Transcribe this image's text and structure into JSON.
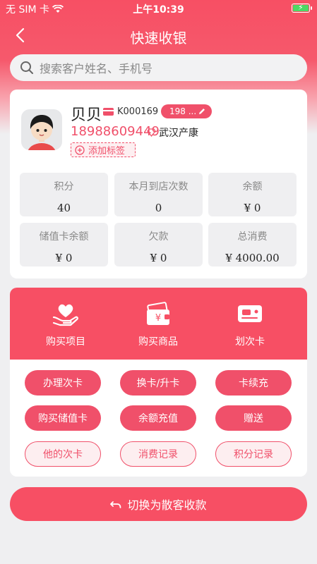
{
  "status_bar": {
    "carrier": "无 SIM 卡",
    "time": "上午10:39"
  },
  "nav": {
    "title": "快速收银"
  },
  "search": {
    "placeholder": "搜索客户姓名、手机号"
  },
  "customer": {
    "name": "贝贝",
    "card_no": "K000169",
    "tag_pill": "198 ...",
    "phone": "18988609449",
    "store": "武汉产康",
    "add_tag_label": "添加标签"
  },
  "stats": [
    {
      "label": "积分",
      "value": "40"
    },
    {
      "label": "本月到店次数",
      "value": "0"
    },
    {
      "label": "余额",
      "value": "¥ 0"
    },
    {
      "label": "储值卡余额",
      "value": "¥ 0"
    },
    {
      "label": "欠款",
      "value": "¥ 0"
    },
    {
      "label": "总消费",
      "value": "¥ 4000.00"
    }
  ],
  "actions": [
    {
      "label": "购买项目",
      "icon": "heart-hand-icon"
    },
    {
      "label": "购买商品",
      "icon": "money-wallet-icon"
    },
    {
      "label": "划次卡",
      "icon": "card-icon"
    }
  ],
  "buttons": [
    {
      "label": "办理次卡",
      "style": "solid"
    },
    {
      "label": "换卡/升卡",
      "style": "solid"
    },
    {
      "label": "卡续充",
      "style": "solid"
    },
    {
      "label": "购买储值卡",
      "style": "solid"
    },
    {
      "label": "余额充值",
      "style": "solid"
    },
    {
      "label": "赠送",
      "style": "solid"
    },
    {
      "label": "他的次卡",
      "style": "ghost"
    },
    {
      "label": "消费记录",
      "style": "ghost"
    },
    {
      "label": "积分记录",
      "style": "ghost"
    }
  ],
  "switch_button": {
    "label": "切换为散客收款"
  },
  "colors": {
    "accent": "#f74f64",
    "accent_soft": "#fdeef0",
    "background": "#efeff1"
  }
}
